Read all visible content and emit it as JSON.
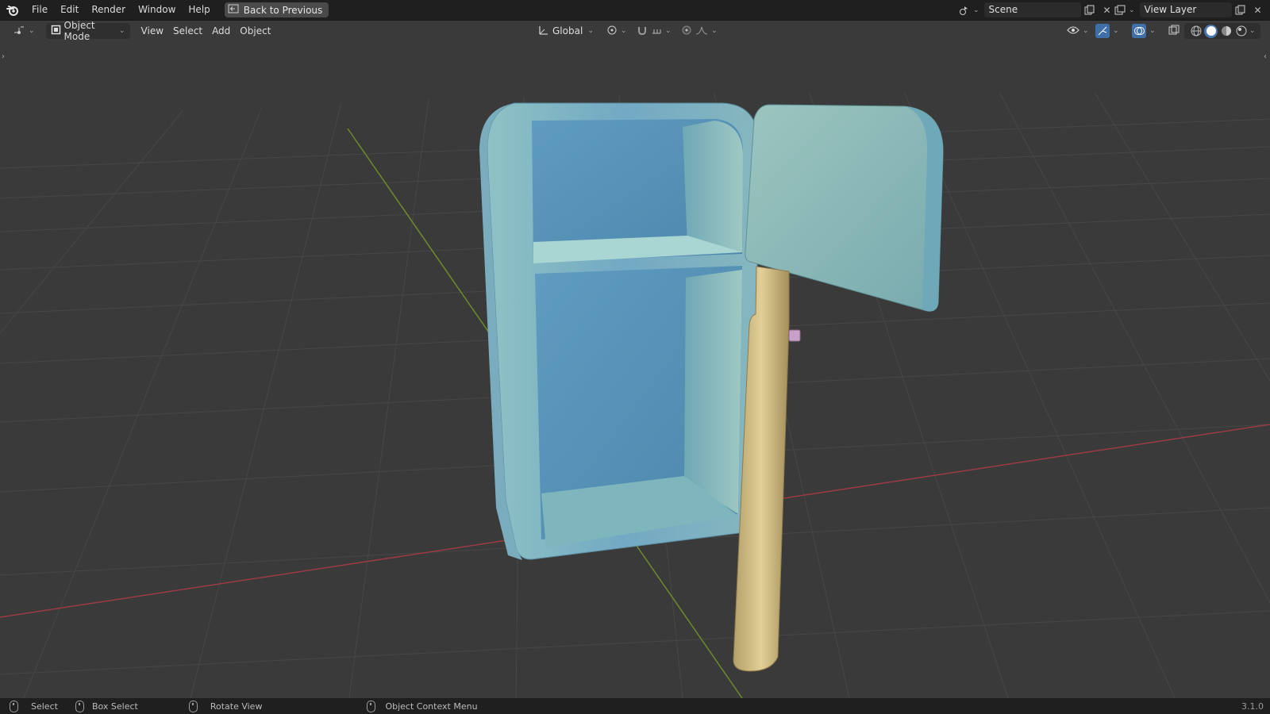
{
  "menu": {
    "file": "File",
    "edit": "Edit",
    "render": "Render",
    "window": "Window",
    "help": "Help"
  },
  "back_button": "Back to Previous",
  "scene": {
    "name": "Scene"
  },
  "view_layer": {
    "name": "View Layer"
  },
  "header": {
    "mode": "Object Mode",
    "view": "View",
    "select": "Select",
    "add": "Add",
    "object": "Object",
    "transform_orientation": "Global"
  },
  "status": {
    "select": "Select",
    "box_select": "Box Select",
    "rotate_view": "Rotate View",
    "context_menu": "Object Context Menu",
    "version": "3.1.0"
  },
  "colors": {
    "fridge_body": "#7fb3c2",
    "fridge_door": "#8fb8b8",
    "door_panel": "#c9b47a",
    "grid_x_axis": "#b84a57",
    "grid_y_axis": "#7f9a3a"
  },
  "icons": [
    "blender-logo",
    "back-icon",
    "scene-icon",
    "view-layer-icon",
    "editor-type-icon",
    "object-mode-icon",
    "transform-icon",
    "pivot-icon",
    "snap-icon",
    "proportional-icon",
    "visibility-icon",
    "gizmo-icon",
    "overlay-icon",
    "xray-icon",
    "shading-wireframe-icon",
    "shading-solid-icon",
    "shading-material-icon",
    "shading-rendered-icon"
  ]
}
